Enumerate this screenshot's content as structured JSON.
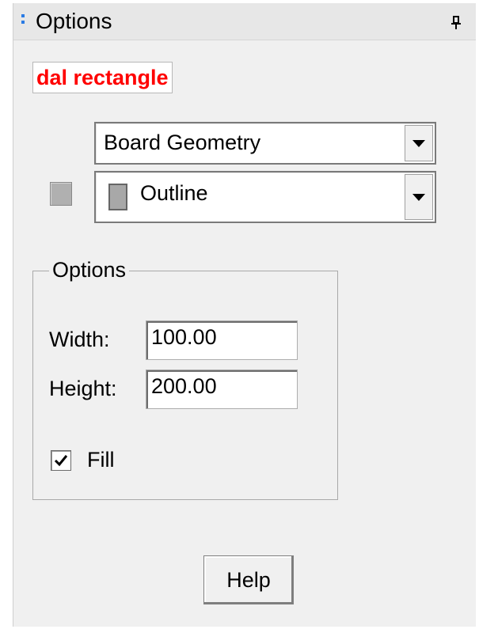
{
  "panel": {
    "title": "Options",
    "pin_icon": "pin-icon",
    "grip_icon": "grip-icon"
  },
  "command_label": "dal rectangle",
  "class_select": {
    "value": "Board Geometry",
    "icon": "chevron-down-icon"
  },
  "subclass_select": {
    "value": "Outline",
    "icon": "chevron-down-icon"
  },
  "group": {
    "title": "Options",
    "width_label": "Width:",
    "width_value": "100.00",
    "height_label": "Height:",
    "height_value": "200.00",
    "fill_label": "Fill",
    "fill_checked": true
  },
  "help_label": "Help",
  "colors": {
    "command_label": "#ff0000",
    "grip": "#2a7be4",
    "swatch": "#a8a8a8",
    "panel_bg": "#f0f0f0"
  }
}
